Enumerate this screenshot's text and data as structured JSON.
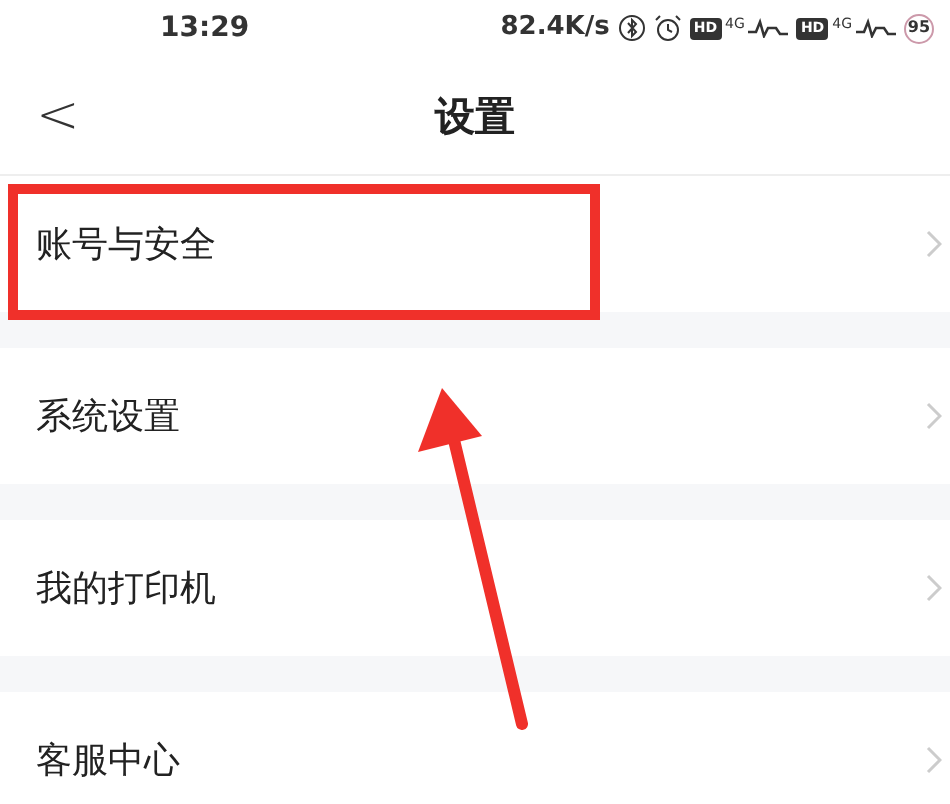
{
  "status_bar": {
    "time": "13:29",
    "speed": "82.4K/s",
    "sim_1": {
      "badge": "HD",
      "network": "4G"
    },
    "sim_2": {
      "badge": "HD",
      "network": "4G"
    },
    "battery": "95"
  },
  "header": {
    "back": "<",
    "title": "设置"
  },
  "rows": [
    {
      "label": "账号与安全",
      "highlighted": true
    },
    {
      "label": "系统设置",
      "highlighted": false
    },
    {
      "label": "我的打印机",
      "highlighted": false
    },
    {
      "label": "客服中心",
      "highlighted": false
    }
  ],
  "annotation": {
    "arrow": true
  }
}
